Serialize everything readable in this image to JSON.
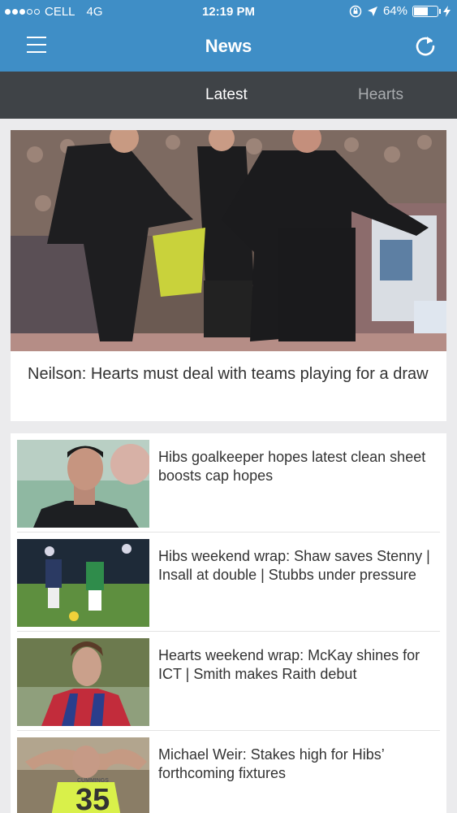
{
  "status_bar": {
    "carrier": "CELL",
    "network": "4G",
    "time": "12:19 PM",
    "battery": "64%",
    "battery_level": 0.64
  },
  "app_bar": {
    "title": "News",
    "menu_icon": "hamburger-menu-icon",
    "refresh_icon": "refresh-icon"
  },
  "tabs": [
    {
      "label": "Latest",
      "active": true
    },
    {
      "label": "Hearts",
      "active": false
    }
  ],
  "featured": {
    "title": "Neilson: Hearts must deal with teams playing for a draw"
  },
  "articles": [
    {
      "title": "Hibs goalkeeper hopes latest clean sheet boosts cap hopes"
    },
    {
      "title": "Hibs weekend wrap: Shaw saves Stenny | Insall at double | Stubbs under pressure"
    },
    {
      "title": "Hearts weekend wrap: McKay shines for ICT | Smith makes Raith debut"
    },
    {
      "title": "Michael Weir: Stakes high for Hibs’ forthcoming fixtures"
    }
  ],
  "image_text": {
    "shirt_name": "CUMMINGS",
    "shirt_number": "35"
  }
}
